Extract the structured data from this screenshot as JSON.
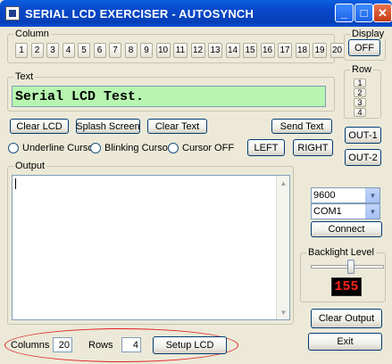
{
  "window": {
    "title": "SERIAL LCD EXERCISER - AUTOSYNCH",
    "minimize": "_",
    "maximize": "□",
    "close": "✕"
  },
  "column_group": {
    "label": "Column",
    "buttons": [
      "1",
      "2",
      "3",
      "4",
      "5",
      "6",
      "7",
      "8",
      "9",
      "10",
      "11",
      "12",
      "13",
      "14",
      "15",
      "16",
      "17",
      "18",
      "19",
      "20"
    ]
  },
  "display_group": {
    "label": "Display",
    "button": "OFF"
  },
  "row_group": {
    "label": "Row",
    "buttons": [
      "1",
      "2",
      "3",
      "4"
    ]
  },
  "text_group": {
    "label": "Text",
    "lcd_text": "Serial LCD Test."
  },
  "actions": {
    "clear_lcd": "Clear LCD",
    "splash_screen": "Splash Screen",
    "clear_text": "Clear Text",
    "send_text": "Send Text",
    "left": "LEFT",
    "right": "RIGHT",
    "out1": "OUT-1",
    "out2": "OUT-2"
  },
  "cursor_options": {
    "underline": "Underline Cursor",
    "blinking": "Blinking Cursor",
    "off": "Cursor OFF"
  },
  "output_group": {
    "label": "Output"
  },
  "serial": {
    "baud": "9600",
    "port": "COM1",
    "connect": "Connect"
  },
  "backlight": {
    "label": "Backlight Level",
    "value": "155",
    "level_fraction": 0.56
  },
  "bottom_actions": {
    "clear_output": "Clear Output",
    "exit": "Exit"
  },
  "lcd_setup": {
    "columns_label": "Columns",
    "columns_value": "20",
    "rows_label": "Rows",
    "rows_value": "4",
    "setup_button": "Setup LCD"
  }
}
